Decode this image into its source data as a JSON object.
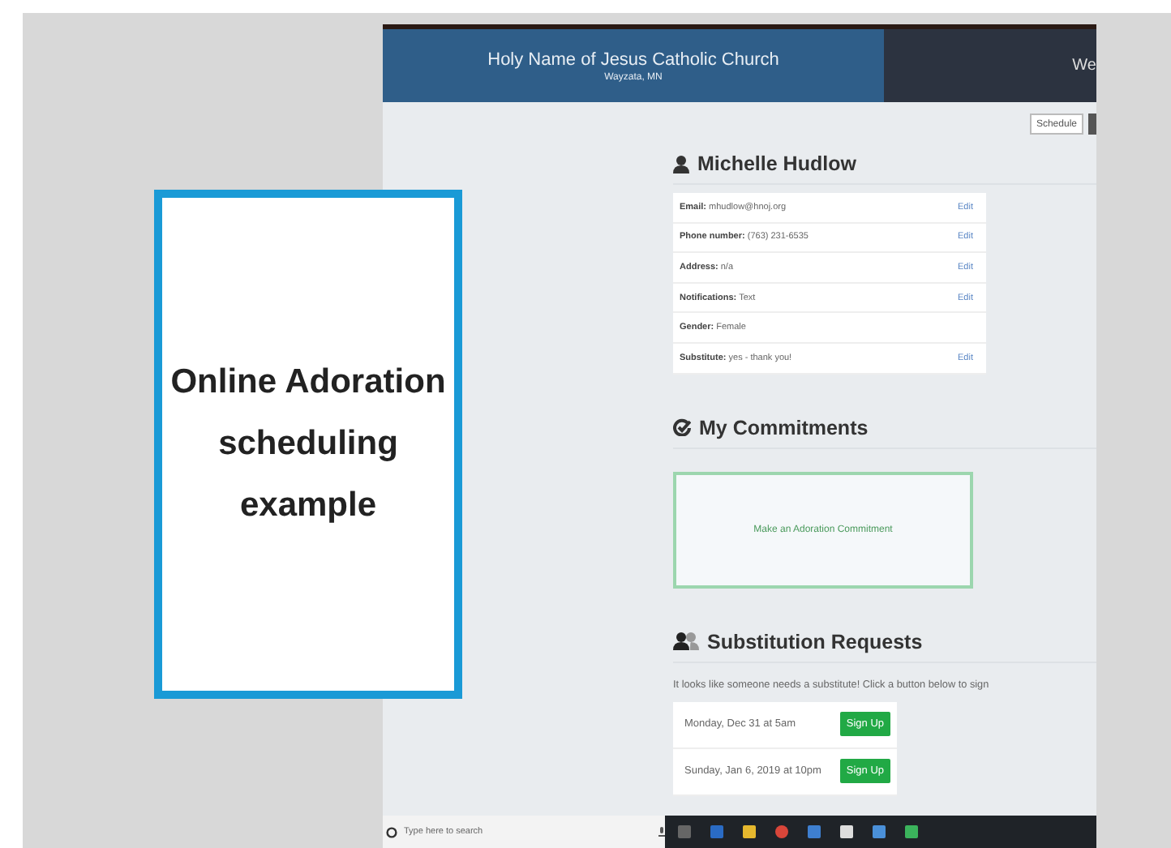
{
  "callout": {
    "text": "Online Adoration scheduling example"
  },
  "header": {
    "title": "Holy Name of Jesus Catholic Church",
    "subtitle": "Wayzata, MN",
    "right_text": "We"
  },
  "toolbar": {
    "button": "Schedule"
  },
  "profile": {
    "name": "Michelle Hudlow",
    "fields": [
      {
        "label": "Email:",
        "value": "mhudlow@hnoj.org",
        "action": "Edit"
      },
      {
        "label": "Phone number:",
        "value": "(763) 231-6535",
        "action": "Edit"
      },
      {
        "label": "Address:",
        "value": "n/a",
        "action": "Edit"
      },
      {
        "label": "Notifications:",
        "value": "Text",
        "action": "Edit"
      },
      {
        "label": "Gender:",
        "value": "Female"
      },
      {
        "label": "Substitute:",
        "value": "yes - thank you!",
        "action": "Edit"
      }
    ]
  },
  "commitments": {
    "title": "My Commitments",
    "button": "Make an Adoration Commitment"
  },
  "substitutions": {
    "title": "Substitution Requests",
    "message": "It looks like someone needs a substitute! Click a button below to sign",
    "requests": [
      {
        "when": "Monday, Dec 31 at 5am",
        "button": "Sign Up"
      },
      {
        "when": "Sunday, Jan 6, 2019 at 10pm",
        "button": "Sign Up"
      }
    ]
  },
  "taskbar": {
    "search_placeholder": "Type here to search"
  }
}
